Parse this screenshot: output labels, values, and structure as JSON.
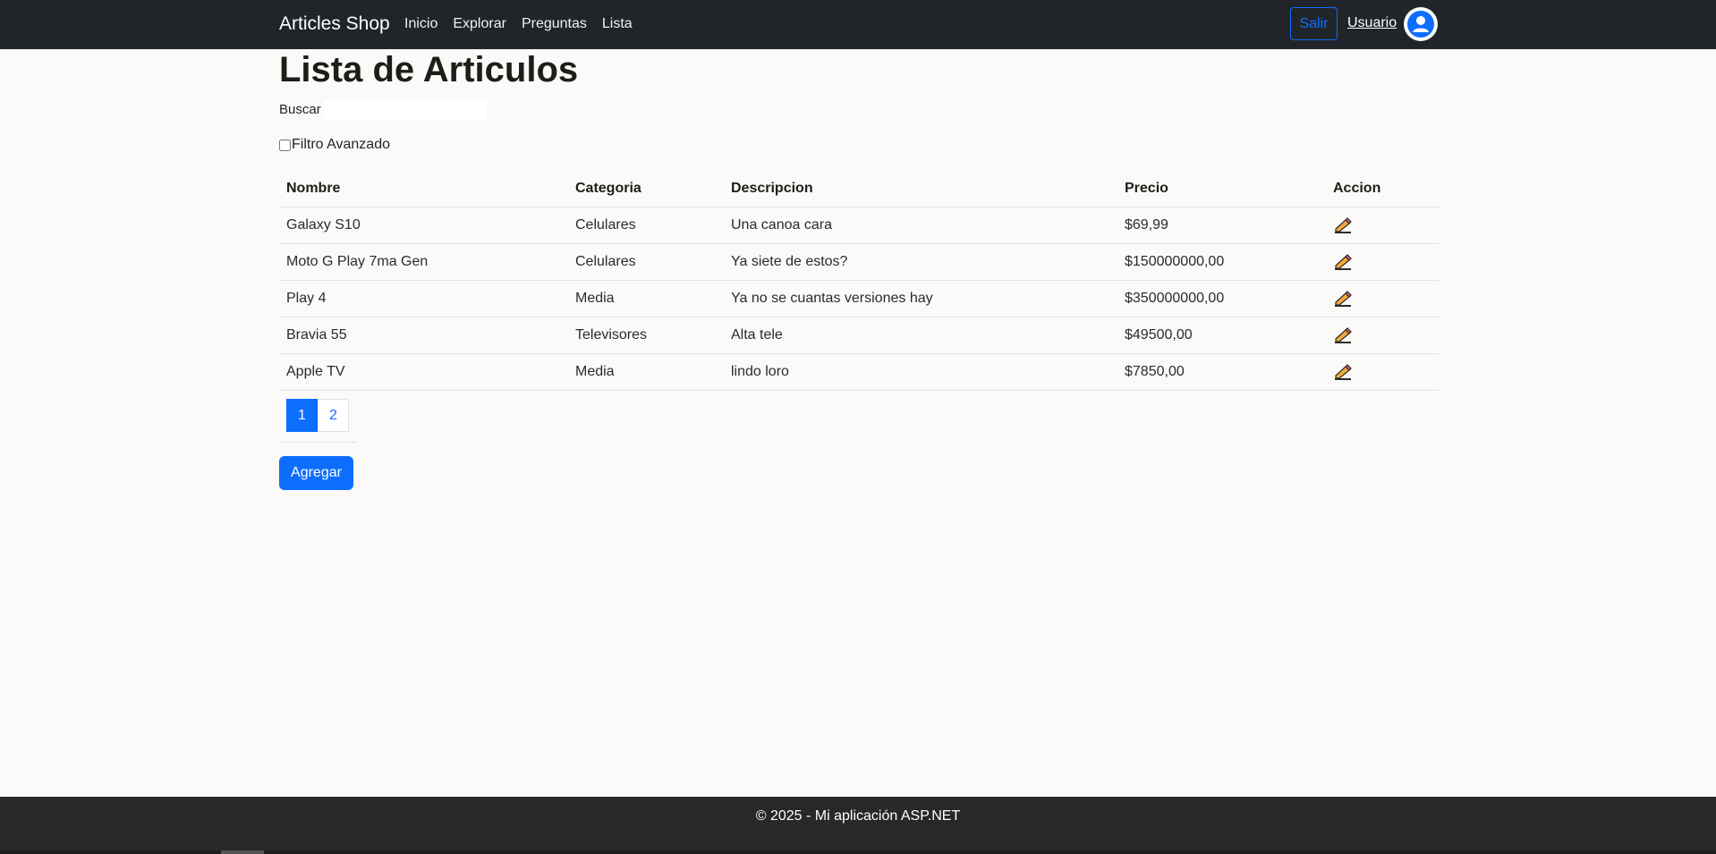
{
  "navbar": {
    "brand": "Articles Shop",
    "links": [
      "Inicio",
      "Explorar",
      "Preguntas",
      "Lista"
    ],
    "logout_label": "Salir",
    "user_label": "Usuario",
    "avatar_icon": "user-avatar-icon"
  },
  "page": {
    "title": "Lista de Articulos",
    "search_label": "Buscar",
    "search_value": "",
    "filter_label": "Filtro Avanzado",
    "filter_checked": false
  },
  "table": {
    "headers": [
      "Nombre",
      "Categoria",
      "Descripcion",
      "Precio",
      "Accion"
    ],
    "rows": [
      {
        "nombre": "Galaxy S10",
        "categoria": "Celulares",
        "descripcion": "Una canoa cara",
        "precio": "$69,99",
        "accion_icon": "edit-pencil-icon"
      },
      {
        "nombre": "Moto G Play 7ma Gen",
        "categoria": "Celulares",
        "descripcion": "Ya siete de estos?",
        "precio": "$150000000,00",
        "accion_icon": "edit-pencil-icon"
      },
      {
        "nombre": "Play 4",
        "categoria": "Media",
        "descripcion": "Ya no se cuantas versiones hay",
        "precio": "$350000000,00",
        "accion_icon": "edit-pencil-icon"
      },
      {
        "nombre": "Bravia 55",
        "categoria": "Televisores",
        "descripcion": "Alta tele",
        "precio": "$49500,00",
        "accion_icon": "edit-pencil-icon"
      },
      {
        "nombre": "Apple TV",
        "categoria": "Media",
        "descripcion": "lindo loro",
        "precio": "$7850,00",
        "accion_icon": "edit-pencil-icon"
      }
    ]
  },
  "pager": {
    "pages": [
      "1",
      "2"
    ],
    "active": "1"
  },
  "add_button_label": "Agregar",
  "footer": {
    "text": "© 2025 - Mi aplicación ASP.NET"
  },
  "colors": {
    "navbar_bg": "#212529",
    "accent": "#0d6efd",
    "page_bg": "#fbfaf8",
    "footer_bg": "#282828"
  }
}
